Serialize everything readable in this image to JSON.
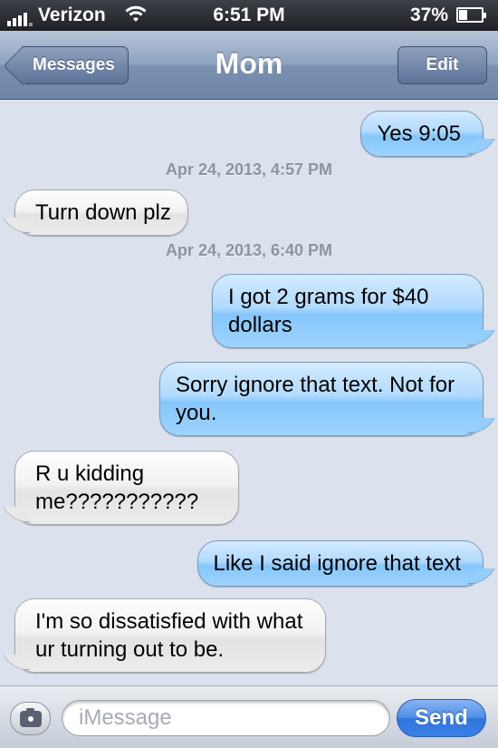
{
  "status_bar": {
    "carrier": "Verizon",
    "time": "6:51 PM",
    "battery_percent": "37%",
    "battery_level": 0.37,
    "icons": [
      "signal-icon",
      "wifi-icon",
      "battery-icon"
    ]
  },
  "nav": {
    "back_label": "Messages",
    "title": "Mom",
    "edit_label": "Edit"
  },
  "thread": {
    "items": [
      {
        "kind": "sent",
        "text": "Yes 9:05"
      },
      {
        "kind": "timestamp",
        "text": "Apr 24, 2013, 4:57 PM"
      },
      {
        "kind": "received",
        "text": "Turn down plz"
      },
      {
        "kind": "timestamp",
        "text": "Apr 24, 2013, 6:40 PM"
      },
      {
        "kind": "sent",
        "text": "I got 2 grams for $40 dollars"
      },
      {
        "kind": "sent",
        "text": "Sorry ignore that text. Not for you."
      },
      {
        "kind": "received",
        "text": "R u kidding me???????????"
      },
      {
        "kind": "sent",
        "text": "Like I said ignore that text"
      },
      {
        "kind": "received",
        "text": "I'm so dissatisfied with what ur turning out to be."
      }
    ]
  },
  "composer": {
    "camera_icon": "camera-icon",
    "placeholder": "iMessage",
    "send_label": "Send"
  },
  "colors": {
    "sent_bubble": "#9ed3fc",
    "received_bubble": "#ececec",
    "background": "#dbe2ed",
    "send_button": "#3b80e4"
  }
}
